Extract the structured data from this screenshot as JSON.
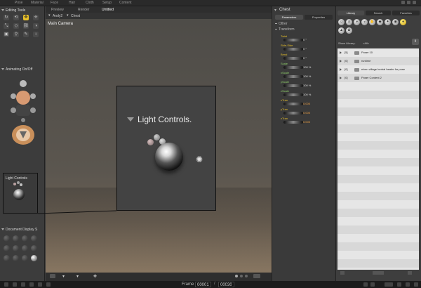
{
  "room_tabs": [
    "Pose",
    "Material",
    "Face",
    "Hair",
    "Cloth",
    "Setup",
    "Content"
  ],
  "left_panel": {
    "editing_tools_title": "Editing Tools",
    "animating_title": "Animating On/Off",
    "light_controls_title": "Light Controls",
    "document_display_title": "Document Display S"
  },
  "viewport": {
    "tabs": [
      "Preview",
      "Render",
      "Untitled"
    ],
    "figure": "Andy2",
    "actor": "Chest",
    "camera_label": "Main Camera"
  },
  "callout": {
    "title": "Light Controls."
  },
  "parameters_panel": {
    "title": "Chest",
    "tabs": [
      "Parameters",
      "Properties"
    ],
    "sections": [
      "Other",
      "Transform"
    ],
    "dials": [
      {
        "label": "Twist",
        "value": "0 °"
      },
      {
        "label": "Side-Side",
        "value": "0 °"
      },
      {
        "label": "Bend",
        "value": "0 °"
      },
      {
        "label": "Scale",
        "value": "100 %"
      },
      {
        "label": "xScale",
        "value": "100 %"
      },
      {
        "label": "yScale",
        "value": "100 %"
      },
      {
        "label": "zScale",
        "value": "100 %"
      },
      {
        "label": "xTran",
        "value": "0.000"
      },
      {
        "label": "yTran",
        "value": "0.000"
      },
      {
        "label": "zTran",
        "value": "0.000"
      }
    ]
  },
  "library": {
    "tabs": [
      "Library",
      "Search",
      "Favorites"
    ],
    "show_library_label": "Show Library:",
    "show_library_value": "<All>",
    "items": [
      {
        "count": "[5]",
        "name": "Poser 10"
      },
      {
        "count": "[0]",
        "name": "runtime"
      },
      {
        "count": "[0]",
        "name": "elven village herbal healer for pose"
      },
      {
        "count": "[0]",
        "name": "Poser Content 2"
      }
    ]
  },
  "timeline": {
    "frame_label": "Frame",
    "current_frame": "00001",
    "total_frames": "00030"
  },
  "colors": {
    "accent": "#e8c02a",
    "viewport_bg": "#5b564f",
    "library_list_bg": "#e6e6e6"
  }
}
